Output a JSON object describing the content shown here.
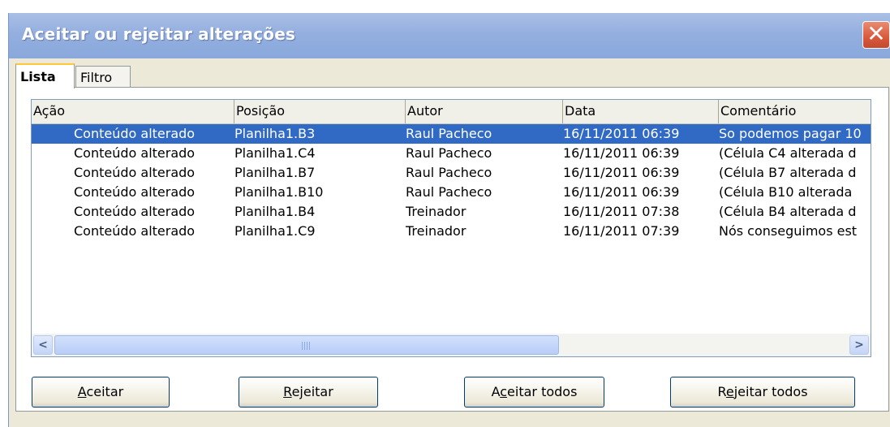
{
  "window": {
    "title": "Aceitar ou rejeitar alterações",
    "close_symbol": "✕"
  },
  "tabs": [
    {
      "label": "Lista",
      "active": true
    },
    {
      "label": "Filtro",
      "active": false
    }
  ],
  "list": {
    "columns": [
      "Ação",
      "Posição",
      "Autor",
      "Data",
      "Comentário"
    ],
    "rows": [
      {
        "action": "Conteúdo alterado",
        "position": "Planilha1.B3",
        "author": "Raul Pacheco",
        "date": "16/11/2011 06:39",
        "comment": "So podemos pagar 10",
        "selected": true
      },
      {
        "action": "Conteúdo alterado",
        "position": "Planilha1.C4",
        "author": "Raul Pacheco",
        "date": "16/11/2011 06:39",
        "comment": "(Célula C4 alterada d",
        "selected": false
      },
      {
        "action": "Conteúdo alterado",
        "position": "Planilha1.B7",
        "author": "Raul Pacheco",
        "date": "16/11/2011 06:39",
        "comment": "(Célula B7 alterada d",
        "selected": false
      },
      {
        "action": "Conteúdo alterado",
        "position": "Planilha1.B10",
        "author": "Raul Pacheco",
        "date": "16/11/2011 06:39",
        "comment": "(Célula B10 alterada",
        "selected": false
      },
      {
        "action": "Conteúdo alterado",
        "position": "Planilha1.B4",
        "author": "Treinador",
        "date": "16/11/2011 07:38",
        "comment": "(Célula B4 alterada d",
        "selected": false
      },
      {
        "action": "Conteúdo alterado",
        "position": "Planilha1.C9",
        "author": "Treinador",
        "date": "16/11/2011 07:39",
        "comment": "Nós conseguimos est",
        "selected": false
      }
    ]
  },
  "scrollbar": {
    "left_icon": "chevron-left-icon",
    "right_icon": "chevron-right-icon",
    "left_symbol": "<",
    "right_symbol": ">"
  },
  "buttons": {
    "accept": {
      "accel": "A",
      "rest": "ceitar"
    },
    "reject": {
      "accel": "R",
      "rest": "ejeitar"
    },
    "accept_all": {
      "pre": "A",
      "accel": "c",
      "rest": "eitar todos"
    },
    "reject_all": {
      "pre": "R",
      "accel": "e",
      "rest": "jeitar todos"
    }
  },
  "colors": {
    "title_bar": "#94afdf",
    "selection": "#316ac5",
    "dialog_bg": "#ece9d8",
    "close_button": "#d9593b"
  }
}
